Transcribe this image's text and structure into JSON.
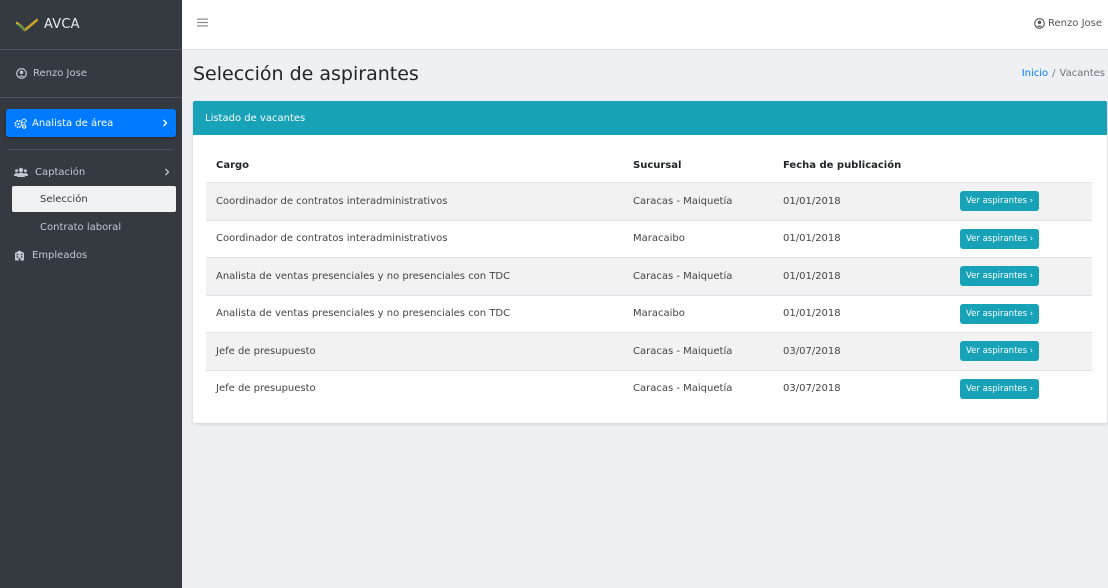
{
  "sidebar": {
    "brand": "AVCA",
    "user": "Renzo Jose",
    "active_item": "Analista de área",
    "section_item": "Captación",
    "sub_items": [
      "Selección",
      "Contrato laboral"
    ],
    "employees_item": "Empleados"
  },
  "topbar": {
    "user": "Renzo Jose"
  },
  "page": {
    "title": "Selección de aspirantes",
    "breadcrumb": {
      "home": "Inicio",
      "separator": "/",
      "current": "Vacantes"
    }
  },
  "card": {
    "header": "Listado de vacantes",
    "columns": [
      "Cargo",
      "Sucursal",
      "Fecha de publicación"
    ],
    "rows": [
      {
        "cargo": "Coordinador de contratos interadministrativos",
        "sucursal": "Caracas - Maiquetía",
        "fecha": "01/01/2018",
        "action": "Ver aspirantes ›"
      },
      {
        "cargo": "Coordinador de contratos interadministrativos",
        "sucursal": "Maracaibo",
        "fecha": "01/01/2018",
        "action": "Ver aspirantes ›"
      },
      {
        "cargo": "Analista de ventas presenciales y no presenciales con TDC",
        "sucursal": "Caracas - Maiquetía",
        "fecha": "01/01/2018",
        "action": "Ver aspirantes ›"
      },
      {
        "cargo": "Analista de ventas presenciales y no presenciales con TDC",
        "sucursal": "Maracaibo",
        "fecha": "01/01/2018",
        "action": "Ver aspirantes ›"
      },
      {
        "cargo": "Jefe de presupuesto",
        "sucursal": "Caracas - Maiquetía",
        "fecha": "03/07/2018",
        "action": "Ver aspirantes ›"
      },
      {
        "cargo": "Jefe de presupuesto",
        "sucursal": "Caracas - Maiquetía",
        "fecha": "03/07/2018",
        "action": "Ver aspirantes ›"
      }
    ]
  },
  "icons": {
    "brand": "check-logo-icon",
    "user": "user-circle-icon",
    "active_item": "cogs-icon",
    "section": "users-icon",
    "employees": "building-icon",
    "menu": "hamburger-icon",
    "chevron": "chevron-right-icon"
  },
  "colors": {
    "sidebar_bg": "#343a40",
    "active_item": "#007bff",
    "header_teal": "#17a2b8",
    "button": "#17a2b8",
    "breadcrumb_link": "#007bff"
  }
}
